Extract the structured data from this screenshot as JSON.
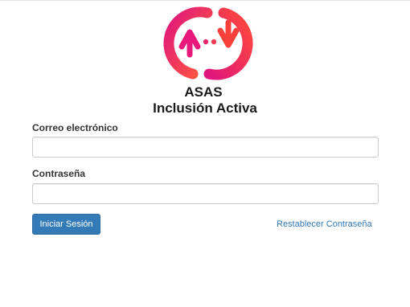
{
  "brand": {
    "logo_icon": "sync-arrows-logo-icon",
    "org_name": "ASAS",
    "app_name": "Inclusión Activa",
    "colors": {
      "logo_gradient_start": "#e6197f",
      "logo_gradient_end": "#ff5a3c"
    }
  },
  "form": {
    "email_label": "Correo electrónico",
    "email_value": "",
    "email_placeholder": "",
    "password_label": "Contraseña",
    "password_value": "",
    "password_placeholder": "",
    "submit_label": "Iniciar Sesión",
    "reset_link_label": "Restablecer Contraseña"
  },
  "colors": {
    "primary": "#337ab7",
    "border": "#cccccc",
    "text": "#333333"
  }
}
